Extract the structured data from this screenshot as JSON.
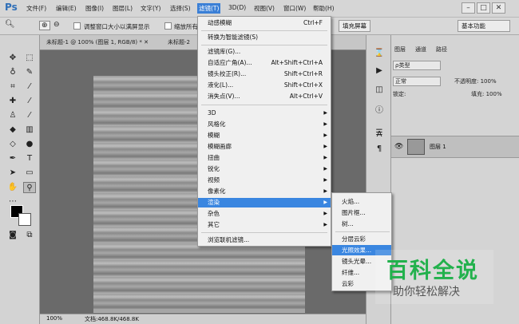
{
  "app": {
    "logo": "Ps"
  },
  "menubar": {
    "items": [
      "文件(F)",
      "编辑(E)",
      "图像(I)",
      "图层(L)",
      "文字(Y)",
      "选择(S)",
      "滤镜(T)",
      "3D(D)",
      "视图(V)",
      "窗口(W)",
      "帮助(H)"
    ],
    "window_controls": [
      "–",
      "□",
      "✕"
    ]
  },
  "options_bar": {
    "fit_label": "调整窗口大小以满屏显示",
    "zoom_all_label": "缩放所有",
    "fill_screen": "填充屏幕",
    "workspace": "基本功能"
  },
  "tabs": [
    "未标题-1 @ 100% (图层 1, RGB/8) * ✕",
    "未标题-2"
  ],
  "status": {
    "zoom": "100%",
    "doc": "文档:468.8K/468.8K"
  },
  "filter_menu": {
    "items": [
      {
        "label": "动感模糊",
        "shortcut": "Ctrl+F"
      },
      {
        "label": "转换为智能滤镜(S)"
      },
      {
        "label": "滤镜库(G)..."
      },
      {
        "label": "自适应广角(A)...",
        "shortcut": "Alt+Shift+Ctrl+A"
      },
      {
        "label": "镜头校正(R)...",
        "shortcut": "Shift+Ctrl+R"
      },
      {
        "label": "液化(L)...",
        "shortcut": "Shift+Ctrl+X"
      },
      {
        "label": "消失点(V)...",
        "shortcut": "Alt+Ctrl+V"
      },
      {
        "label": "3D"
      },
      {
        "label": "风格化"
      },
      {
        "label": "模糊"
      },
      {
        "label": "模糊画廊"
      },
      {
        "label": "扭曲"
      },
      {
        "label": "锐化"
      },
      {
        "label": "视频"
      },
      {
        "label": "像素化"
      },
      {
        "label": "渲染"
      },
      {
        "label": "杂色"
      },
      {
        "label": "其它"
      },
      {
        "label": "浏览联机滤镜..."
      }
    ]
  },
  "render_submenu": {
    "items": [
      "火焰...",
      "图片框...",
      "树...",
      "分层云彩",
      "光照效果...",
      "镜头光晕...",
      "纤维...",
      "云彩"
    ]
  },
  "panels": {
    "tabs": [
      "图层",
      "通道",
      "路径"
    ],
    "kind": "ρ类型",
    "blend_mode": "正常",
    "opacity_label": "不透明度: 100%",
    "lock_label": "锁定:",
    "fill_label": "填充: 100%",
    "layer_name": "图层 1"
  },
  "watermark": {
    "title": "百科全说",
    "subtitle": "助你轻松解决"
  }
}
